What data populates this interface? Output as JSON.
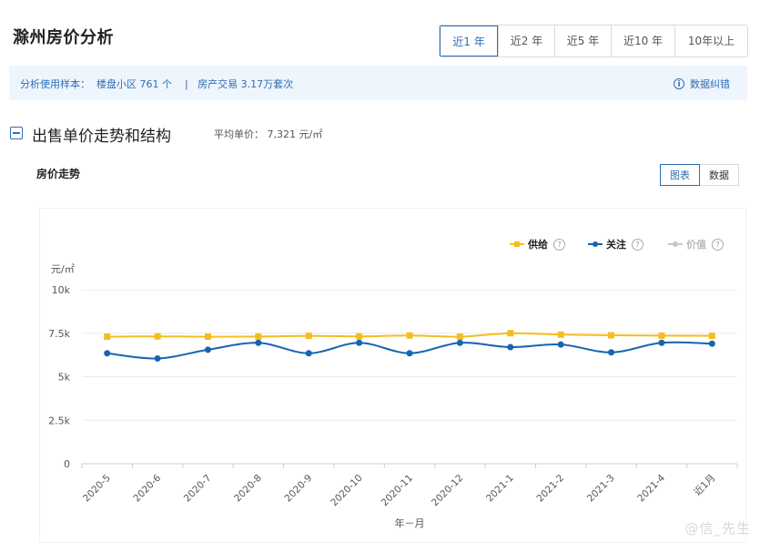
{
  "header": {
    "title": "滁州房价分析"
  },
  "range_tabs": [
    {
      "label": "近1 年",
      "active": true
    },
    {
      "label": "近2 年",
      "active": false
    },
    {
      "label": "近5 年",
      "active": false
    },
    {
      "label": "近10 年",
      "active": false
    },
    {
      "label": "10年以上",
      "active": false
    }
  ],
  "sample": {
    "text": "分析使用样本：  楼盘小区 761 个    |   房产交易 3.17万套次",
    "correction_label": "数据纠错",
    "info_icon": "i"
  },
  "section": {
    "title": "出售单价走势和结构",
    "avg_price": "平均单价：  7,321 元/㎡"
  },
  "trend": {
    "title": "房价走势",
    "view_chart": "图表",
    "view_data": "数据"
  },
  "legend": {
    "help_icon": "?"
  },
  "watermark": "@信_先生",
  "colors": {
    "accent": "#2f6eb5",
    "supply": "#f5bd1f",
    "attention": "#1565b0",
    "value": "#c8c8c8",
    "grid": "#e8e8e8"
  },
  "chart_data": {
    "type": "line",
    "ylabel": "元/㎡",
    "xlabel": "年－月",
    "ylim": [
      0,
      10000
    ],
    "yticks": [
      "0",
      "2.5k",
      "5k",
      "7.5k",
      "10k"
    ],
    "ytick_values": [
      0,
      2500,
      5000,
      7500,
      10000
    ],
    "grid": true,
    "legend_position": "top-right",
    "categories": [
      "2020-5",
      "2020-6",
      "2020-7",
      "2020-8",
      "2020-9",
      "2020-10",
      "2020-11",
      "2020-12",
      "2021-1",
      "2021-2",
      "2021-3",
      "2021-4",
      "近1月"
    ],
    "series": [
      {
        "name": "供给",
        "color": "#f5bd1f",
        "marker": "square",
        "enabled": true,
        "values": [
          7300,
          7320,
          7300,
          7310,
          7350,
          7320,
          7370,
          7300,
          7500,
          7420,
          7380,
          7360,
          7350
        ]
      },
      {
        "name": "关注",
        "color": "#1565b0",
        "marker": "circle",
        "enabled": true,
        "values": [
          6350,
          6050,
          6550,
          6950,
          6350,
          6950,
          6350,
          6950,
          6700,
          6850,
          6400,
          6950,
          6900
        ]
      },
      {
        "name": "价值",
        "color": "#c8c8c8",
        "marker": "circle",
        "enabled": false,
        "values": []
      }
    ]
  }
}
